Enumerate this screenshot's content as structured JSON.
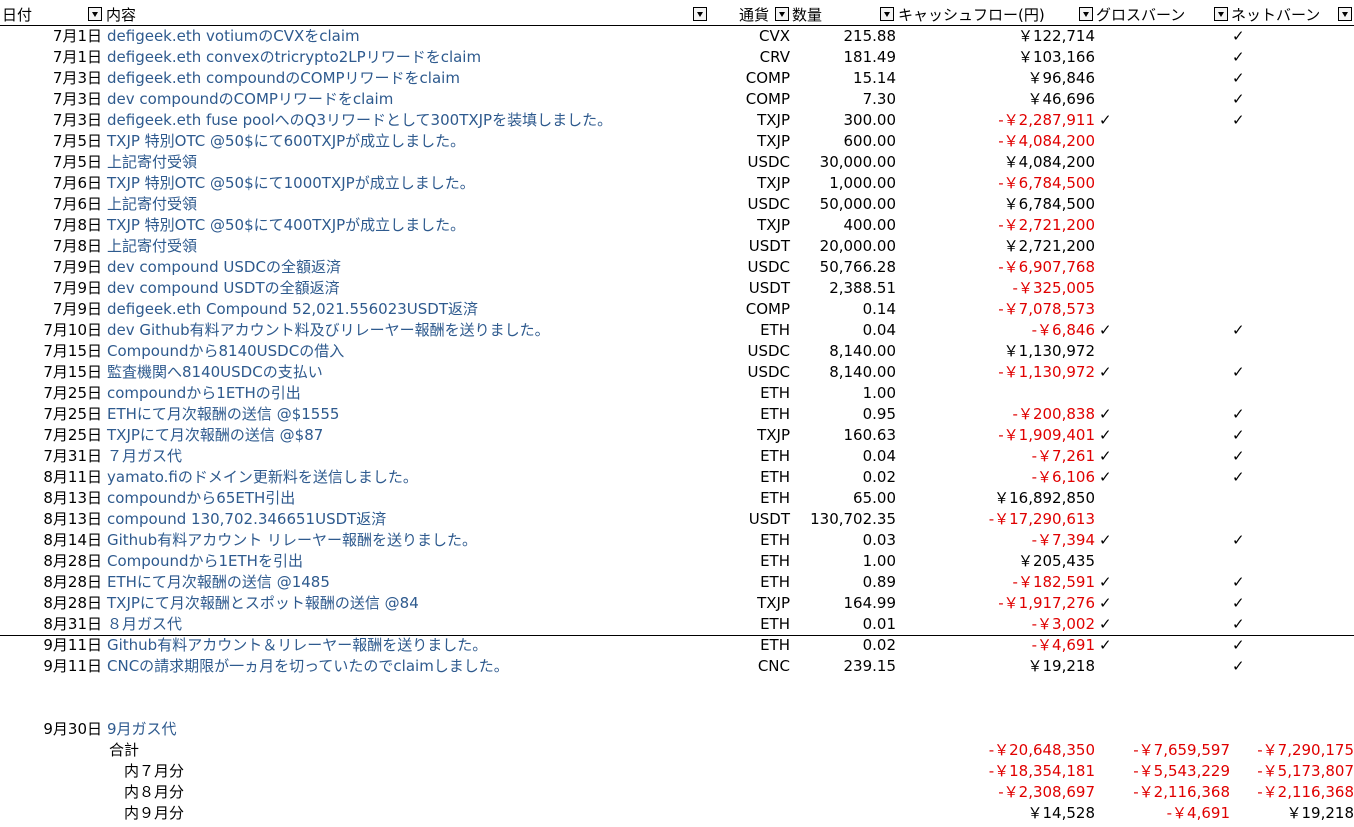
{
  "headers": {
    "date": "日付",
    "content": "内容",
    "currency": "通貨",
    "quantity": "数量",
    "cashflow": "キャッシュフロー(円)",
    "gross_burn": "グロスバーン",
    "net_burn": "ネットバーン"
  },
  "check_mark": "✓",
  "rows": [
    {
      "date": "7月1日",
      "content": "defigeek.eth  votiumのCVXをclaim",
      "currency": "CVX",
      "qty": "215.88",
      "cf": "￥122,714",
      "neg": false,
      "gross": false,
      "net": true
    },
    {
      "date": "7月1日",
      "content": "defigeek.eth  convexのtricrypto2LPリワードをclaim",
      "currency": "CRV",
      "qty": "181.49",
      "cf": "￥103,166",
      "neg": false,
      "gross": false,
      "net": true
    },
    {
      "date": "7月3日",
      "content": "defigeek.eth   compoundのCOMPリワードをclaim",
      "currency": "COMP",
      "qty": "15.14",
      "cf": "￥96,846",
      "neg": false,
      "gross": false,
      "net": true
    },
    {
      "date": "7月3日",
      "content": "dev   compoundのCOMPリワードをclaim",
      "currency": "COMP",
      "qty": "7.30",
      "cf": "￥46,696",
      "neg": false,
      "gross": false,
      "net": true
    },
    {
      "date": "7月3日",
      "content": "defigeek.eth   fuse poolへのQ3リワードとして300TXJPを装填しました。",
      "currency": "TXJP",
      "qty": "300.00",
      "cf": "-￥2,287,911",
      "neg": true,
      "gross": true,
      "net": true
    },
    {
      "date": "7月5日",
      "content": "TXJP 特別OTC   @50$にて600TXJPが成立しました。",
      "currency": "TXJP",
      "qty": "600.00",
      "cf": "-￥4,084,200",
      "neg": true,
      "gross": false,
      "net": false
    },
    {
      "date": "7月5日",
      "content": "上記寄付受領",
      "currency": "USDC",
      "qty": "30,000.00",
      "cf": "￥4,084,200",
      "neg": false,
      "gross": false,
      "net": false
    },
    {
      "date": "7月6日",
      "content": "TXJP 特別OTC   @50$にて1000TXJPが成立しました。",
      "currency": "TXJP",
      "qty": "1,000.00",
      "cf": "-￥6,784,500",
      "neg": true,
      "gross": false,
      "net": false
    },
    {
      "date": "7月6日",
      "content": "上記寄付受領",
      "currency": "USDC",
      "qty": "50,000.00",
      "cf": "￥6,784,500",
      "neg": false,
      "gross": false,
      "net": false
    },
    {
      "date": "7月8日",
      "content": "TXJP 特別OTC   @50$にて400TXJPが成立しました。",
      "currency": "TXJP",
      "qty": "400.00",
      "cf": "-￥2,721,200",
      "neg": true,
      "gross": false,
      "net": false
    },
    {
      "date": "7月8日",
      "content": "上記寄付受領",
      "currency": "USDT",
      "qty": "20,000.00",
      "cf": "￥2,721,200",
      "neg": false,
      "gross": false,
      "net": false
    },
    {
      "date": "7月9日",
      "content": "dev  compound   USDCの全額返済",
      "currency": "USDC",
      "qty": "50,766.28",
      "cf": "-￥6,907,768",
      "neg": true,
      "gross": false,
      "net": false
    },
    {
      "date": "7月9日",
      "content": "dev  compound   USDTの全額返済",
      "currency": "USDT",
      "qty": "2,388.51",
      "cf": "-￥325,005",
      "neg": true,
      "gross": false,
      "net": false
    },
    {
      "date": "7月9日",
      "content": "defigeek.eth  Compound   52,021.556023USDT返済",
      "currency": "COMP",
      "qty": "0.14",
      "cf": "-￥7,078,573",
      "neg": true,
      "gross": false,
      "net": false
    },
    {
      "date": "7月10日",
      "content": "dev   Github有料アカウント料及びリレーヤー報酬を送りました。",
      "currency": "ETH",
      "qty": "0.04",
      "cf": "-￥6,846",
      "neg": true,
      "gross": true,
      "net": true
    },
    {
      "date": "7月15日",
      "content": "Compoundから8140USDCの借入",
      "currency": "USDC",
      "qty": "8,140.00",
      "cf": "￥1,130,972",
      "neg": false,
      "gross": false,
      "net": false
    },
    {
      "date": "7月15日",
      "content": "監査機関へ8140USDCの支払い",
      "currency": "USDC",
      "qty": "8,140.00",
      "cf": "-￥1,130,972",
      "neg": true,
      "gross": true,
      "net": true
    },
    {
      "date": "7月25日",
      "content": "compoundから1ETHの引出",
      "currency": "ETH",
      "qty": "1.00",
      "cf": "",
      "neg": false,
      "gross": false,
      "net": false
    },
    {
      "date": "7月25日",
      "content": "ETHにて月次報酬の送信    @$1555",
      "currency": "ETH",
      "qty": "0.95",
      "cf": "-￥200,838",
      "neg": true,
      "gross": true,
      "net": true
    },
    {
      "date": "7月25日",
      "content": "TXJPにて月次報酬の送信    @$87",
      "currency": "TXJP",
      "qty": "160.63",
      "cf": "-￥1,909,401",
      "neg": true,
      "gross": true,
      "net": true
    },
    {
      "date": "7月31日",
      "content": "７月ガス代",
      "currency": "ETH",
      "qty": "0.04",
      "cf": "-￥7,261",
      "neg": true,
      "gross": true,
      "net": true
    },
    {
      "date": "8月11日",
      "content": "yamato.fiのドメイン更新料を送信しました。",
      "currency": "ETH",
      "qty": "0.02",
      "cf": "-￥6,106",
      "neg": true,
      "gross": true,
      "net": true
    },
    {
      "date": "8月13日",
      "content": "compoundから65ETH引出",
      "currency": "ETH",
      "qty": "65.00",
      "cf": "￥16,892,850",
      "neg": false,
      "gross": false,
      "net": false
    },
    {
      "date": "8月13日",
      "content": "compound  130,702.346651USDT返済",
      "currency": "USDT",
      "qty": "130,702.35",
      "cf": "-￥17,290,613",
      "neg": true,
      "gross": false,
      "net": false
    },
    {
      "date": "8月14日",
      "content": "Github有料アカウント   リレーヤー報酬を送りました。",
      "currency": "ETH",
      "qty": "0.03",
      "cf": "-￥7,394",
      "neg": true,
      "gross": true,
      "net": true
    },
    {
      "date": "8月28日",
      "content": "Compoundから1ETHを引出",
      "currency": "ETH",
      "qty": "1.00",
      "cf": "￥205,435",
      "neg": false,
      "gross": false,
      "net": false
    },
    {
      "date": "8月28日",
      "content": "ETHにて月次報酬の送信    @1485",
      "currency": "ETH",
      "qty": "0.89",
      "cf": "-￥182,591",
      "neg": true,
      "gross": true,
      "net": true
    },
    {
      "date": "8月28日",
      "content": "TXJPにて月次報酬とスポット報酬の送信    @84",
      "currency": "TXJP",
      "qty": "164.99",
      "cf": "-￥1,917,276",
      "neg": true,
      "gross": true,
      "net": true
    },
    {
      "date": "8月31日",
      "content": "８月ガス代",
      "currency": "ETH",
      "qty": "0.01",
      "cf": "-￥3,002",
      "neg": true,
      "gross": true,
      "net": true
    },
    {
      "date": "9月11日",
      "content": "Github有料アカウント＆リレーヤー報酬を送りました。",
      "currency": "ETH",
      "qty": "0.02",
      "cf": "-￥4,691",
      "neg": true,
      "gross": true,
      "net": true
    },
    {
      "date": "9月11日",
      "content": "CNCの請求期限が一ヵ月を切っていたのでclaimしました。",
      "currency": "CNC",
      "qty": "239.15",
      "cf": "￥19,218",
      "neg": false,
      "gross": false,
      "net": true
    }
  ],
  "gas_row": {
    "date": "9月30日",
    "content": "9月ガス代"
  },
  "summary": [
    {
      "label": "合計",
      "cf": "-￥20,648,350",
      "gross": "-￥7,659,597",
      "net": "-￥7,290,175",
      "cf_neg": true,
      "gross_neg": true,
      "net_neg": true
    },
    {
      "label": "内７月分",
      "cf": "-￥18,354,181",
      "gross": "-￥5,543,229",
      "net": "-￥5,173,807",
      "cf_neg": true,
      "gross_neg": true,
      "net_neg": true
    },
    {
      "label": "内８月分",
      "cf": "-￥2,308,697",
      "gross": "-￥2,116,368",
      "net": "-￥2,116,368",
      "cf_neg": true,
      "gross_neg": true,
      "net_neg": true
    },
    {
      "label": "内９月分",
      "cf": "￥14,528",
      "gross": "-￥4,691",
      "net": "￥19,218",
      "cf_neg": false,
      "gross_neg": true,
      "net_neg": false
    }
  ]
}
